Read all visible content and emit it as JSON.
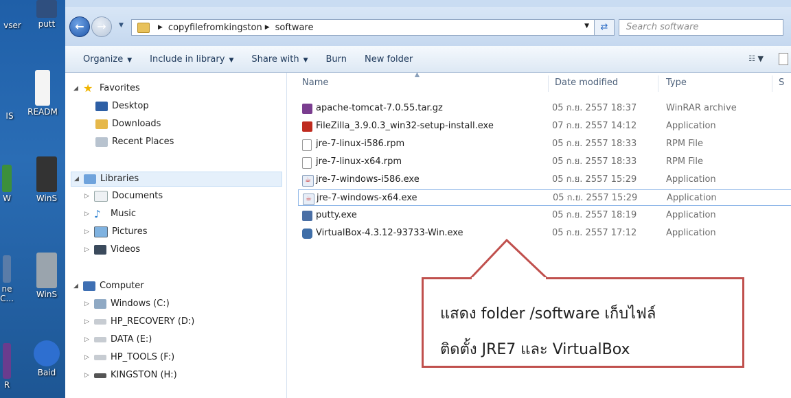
{
  "desktop": {
    "icons": [
      {
        "label": "vser",
        "color": "#3a6fb0"
      },
      {
        "label": "putt",
        "color": "#2f4f7f"
      },
      {
        "label": "IS",
        "color": "#9ab7d8"
      },
      {
        "label": "READM",
        "color": "#f0f0f0"
      },
      {
        "label": "W",
        "color": "#3c8f3c"
      },
      {
        "label": "WinS",
        "color": "#333333"
      },
      {
        "label": "ne\nC...",
        "color": "#5a7ca8"
      },
      {
        "label": "WinS",
        "color": "#9aa4ad"
      },
      {
        "label": "R",
        "color": "#6a3c8e"
      },
      {
        "label": "Baid",
        "color": "#2e6fd0"
      }
    ]
  },
  "address": {
    "crumbs": [
      "copyfilefromkingston",
      "software"
    ],
    "search_placeholder": "Search software"
  },
  "toolbar": {
    "organize": "Organize",
    "include": "Include in library",
    "share": "Share with",
    "burn": "Burn",
    "newfolder": "New folder"
  },
  "nav": {
    "favorites": "Favorites",
    "desktop": "Desktop",
    "downloads": "Downloads",
    "recent": "Recent Places",
    "libraries": "Libraries",
    "documents": "Documents",
    "music": "Music",
    "pictures": "Pictures",
    "videos": "Videos",
    "computer": "Computer",
    "drives": [
      "Windows (C:)",
      "HP_RECOVERY (D:)",
      "DATA (E:)",
      "HP_TOOLS (F:)",
      "KINGSTON (H:)"
    ]
  },
  "columns": {
    "name": "Name",
    "date": "Date modified",
    "type": "Type",
    "size": "S"
  },
  "files": [
    {
      "name": "apache-tomcat-7.0.55.tar.gz",
      "date": "05 ก.ย. 2557 18:37",
      "type": "WinRAR archive",
      "icon": "winrar-icon",
      "color": "#7a3d8f"
    },
    {
      "name": "FileZilla_3.9.0.3_win32-setup-install.exe",
      "date": "07 ก.ย. 2557 14:12",
      "type": "Application",
      "icon": "filezilla-icon",
      "color": "#bf2b1f"
    },
    {
      "name": "jre-7-linux-i586.rpm",
      "date": "05 ก.ย. 2557 18:33",
      "type": "RPM File",
      "icon": "blank-file-icon",
      "color": "#ffffff"
    },
    {
      "name": "jre-7-linux-x64.rpm",
      "date": "05 ก.ย. 2557 18:33",
      "type": "RPM File",
      "icon": "blank-file-icon",
      "color": "#ffffff"
    },
    {
      "name": "jre-7-windows-i586.exe",
      "date": "05 ก.ย. 2557 15:29",
      "type": "Application",
      "icon": "java-icon",
      "color": "#e8eef7"
    },
    {
      "name": "jre-7-windows-x64.exe",
      "date": "05 ก.ย. 2557 15:29",
      "type": "Application",
      "icon": "java-icon",
      "color": "#e8eef7"
    },
    {
      "name": "putty.exe",
      "date": "05 ก.ย. 2557 18:19",
      "type": "Application",
      "icon": "putty-icon",
      "color": "#4a6fa5"
    },
    {
      "name": "VirtualBox-4.3.12-93733-Win.exe",
      "date": "05 ก.ย. 2557 17:12",
      "type": "Application",
      "icon": "virtualbox-icon",
      "color": "#3f6ea8"
    }
  ],
  "callout": {
    "line1": "แสดง folder /software เก็บไฟล์",
    "line2": "ติดตั้ง JRE7 และ VirtualBox",
    "border_color": "#c0504d"
  }
}
